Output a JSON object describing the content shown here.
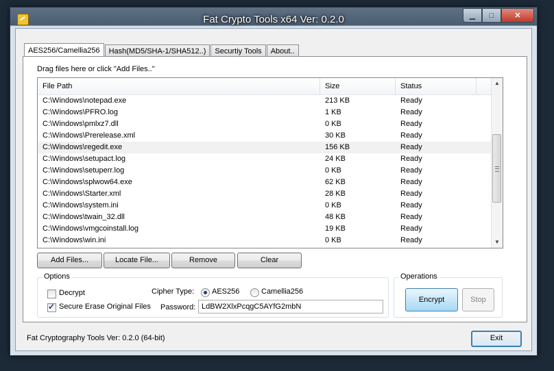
{
  "window": {
    "title": "Fat Crypto Tools x64 Ver: 0.2.0"
  },
  "tabs": [
    {
      "label": "AES256/Camellia256"
    },
    {
      "label": "Hash(MD5/SHA-1/SHA512..)"
    },
    {
      "label": "Securtiy Tools"
    },
    {
      "label": "About.."
    }
  ],
  "main": {
    "drag_hint": "Drag files here or click \"Add Files..\"",
    "columns": [
      "File Path",
      "Size",
      "Status"
    ],
    "rows": [
      {
        "path": "C:\\Windows\\notepad.exe",
        "size": "213 KB",
        "status": "Ready"
      },
      {
        "path": "C:\\Windows\\PFRO.log",
        "size": "1 KB",
        "status": "Ready"
      },
      {
        "path": "C:\\Windows\\pmlxz7.dll",
        "size": "0 KB",
        "status": "Ready"
      },
      {
        "path": "C:\\Windows\\Prerelease.xml",
        "size": "30 KB",
        "status": "Ready"
      },
      {
        "path": "C:\\Windows\\regedit.exe",
        "size": "156 KB",
        "status": "Ready"
      },
      {
        "path": "C:\\Windows\\setupact.log",
        "size": "24 KB",
        "status": "Ready"
      },
      {
        "path": "C:\\Windows\\setuperr.log",
        "size": "0 KB",
        "status": "Ready"
      },
      {
        "path": "C:\\Windows\\splwow64.exe",
        "size": "62 KB",
        "status": "Ready"
      },
      {
        "path": "C:\\Windows\\Starter.xml",
        "size": "28 KB",
        "status": "Ready"
      },
      {
        "path": "C:\\Windows\\system.ini",
        "size": "0 KB",
        "status": "Ready"
      },
      {
        "path": "C:\\Windows\\twain_32.dll",
        "size": "48 KB",
        "status": "Ready"
      },
      {
        "path": "C:\\Windows\\vmgcoinstall.log",
        "size": "19 KB",
        "status": "Ready"
      },
      {
        "path": "C:\\Windows\\win.ini",
        "size": "0 KB",
        "status": "Ready"
      }
    ],
    "buttons": {
      "add": "Add Files...",
      "locate": "Locate File...",
      "remove": "Remove",
      "clear": "Clear"
    }
  },
  "options": {
    "legend": "Options",
    "decrypt_label": "Decrypt",
    "decrypt_checked": false,
    "secure_erase_label": "Secure Erase Original Files",
    "secure_erase_checked": true,
    "cipher_label": "Cipher Type:",
    "cipher_options": [
      "AES256",
      "Camellia256"
    ],
    "cipher_selected": "AES256",
    "password_label": "Password:",
    "password_value": "LdBW2XlxPcqgC5AYfG2mbN"
  },
  "operations": {
    "legend": "Operations",
    "encrypt": "Encrypt",
    "stop": "Stop"
  },
  "footer": {
    "status": "Fat Cryptography Tools Ver: 0.2.0 (64-bit)",
    "exit": "Exit"
  },
  "icons": [
    "app-icon",
    "minimize-icon",
    "maximize-icon",
    "close-icon",
    "scroll-up-arrow-icon",
    "scroll-down-arrow-icon"
  ]
}
